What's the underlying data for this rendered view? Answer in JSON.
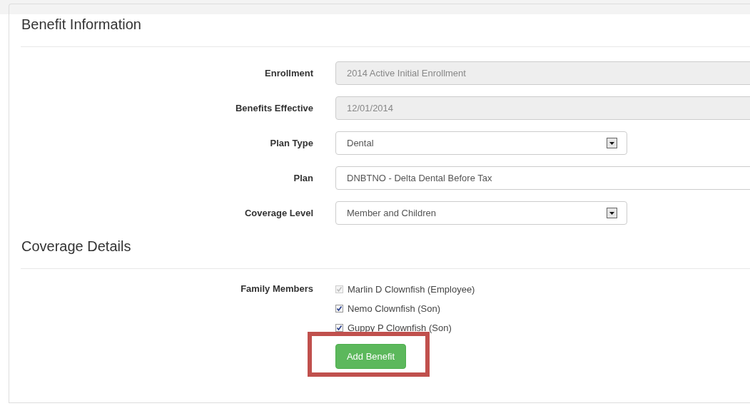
{
  "sections": [
    {
      "title": "Benefit Information",
      "fields": [
        {
          "kind": "text",
          "label": "Enrollment",
          "value": "2014 Active Initial Enrollment",
          "disabled": true
        },
        {
          "kind": "text",
          "label": "Benefits Effective",
          "value": "12/01/2014",
          "disabled": true
        },
        {
          "kind": "select",
          "label": "Plan Type",
          "value": "Dental",
          "disabled": false
        },
        {
          "kind": "text",
          "label": "Plan",
          "value": "DNBTNO - Delta Dental Before Tax",
          "disabled": false
        },
        {
          "kind": "select",
          "label": "Coverage Level",
          "value": "Member and Children",
          "disabled": false
        }
      ]
    },
    {
      "title": "Coverage Details",
      "fields": [
        {
          "kind": "checklist",
          "label": "Family Members",
          "options": [
            {
              "label": "Marlin D Clownfish (Employee)",
              "checked": true,
              "disabled": true
            },
            {
              "label": "Nemo Clownfish (Son)",
              "checked": true,
              "disabled": false
            },
            {
              "label": "Guppy P Clownfish (Son)",
              "checked": true,
              "disabled": false
            }
          ]
        }
      ]
    }
  ],
  "button": {
    "label": "Add Benefit",
    "highlighted": true
  }
}
